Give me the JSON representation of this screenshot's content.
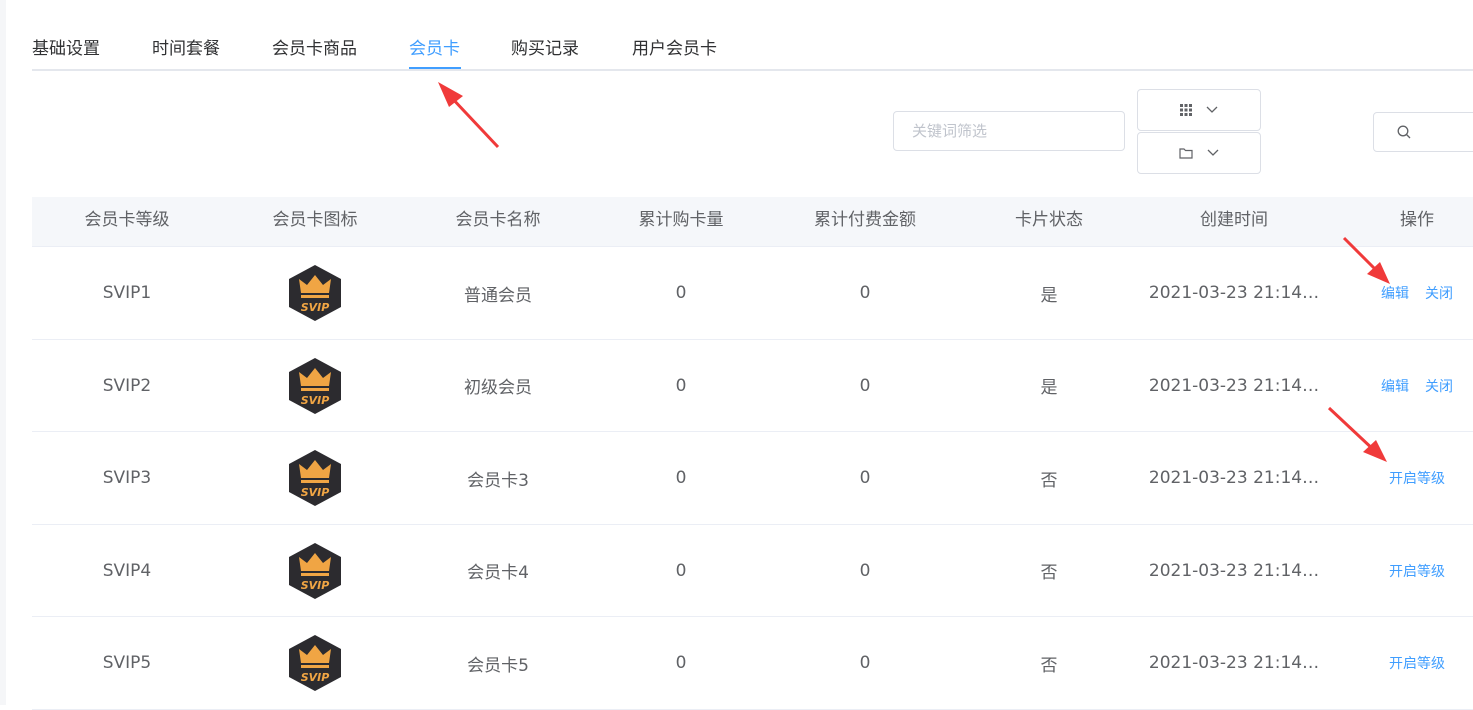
{
  "tabs": [
    {
      "label": "基础设置",
      "active": false
    },
    {
      "label": "时间套餐",
      "active": false
    },
    {
      "label": "会员卡商品",
      "active": false
    },
    {
      "label": "会员卡",
      "active": true
    },
    {
      "label": "购买记录",
      "active": false
    },
    {
      "label": "用户会员卡",
      "active": false
    }
  ],
  "toolbar": {
    "search_placeholder": "关键词筛选",
    "search_value": "",
    "column_icon": "grid-icon",
    "export_icon": "folder-icon",
    "search_icon": "search-icon"
  },
  "table": {
    "headers": [
      "会员卡等级",
      "会员卡图标",
      "会员卡名称",
      "累计购卡量",
      "累计付费金额",
      "卡片状态",
      "创建时间",
      "操作"
    ],
    "rows": [
      {
        "level": "SVIP1",
        "badge": "SVIP",
        "name": "普通会员",
        "count": "0",
        "amount": "0",
        "status": "是",
        "created": "2021-03-23 21:14…",
        "actions": [
          "编辑",
          "关闭"
        ]
      },
      {
        "level": "SVIP2",
        "badge": "SVIP",
        "name": "初级会员",
        "count": "0",
        "amount": "0",
        "status": "是",
        "created": "2021-03-23 21:14…",
        "actions": [
          "编辑",
          "关闭"
        ]
      },
      {
        "level": "SVIP3",
        "badge": "SVIP",
        "name": "会员卡3",
        "count": "0",
        "amount": "0",
        "status": "否",
        "created": "2021-03-23 21:14…",
        "actions": [
          "开启等级"
        ]
      },
      {
        "level": "SVIP4",
        "badge": "SVIP",
        "name": "会员卡4",
        "count": "0",
        "amount": "0",
        "status": "否",
        "created": "2021-03-23 21:14…",
        "actions": [
          "开启等级"
        ]
      },
      {
        "level": "SVIP5",
        "badge": "SVIP",
        "name": "会员卡5",
        "count": "0",
        "amount": "0",
        "status": "否",
        "created": "2021-03-23 21:14…",
        "actions": [
          "开启等级"
        ]
      }
    ]
  },
  "colors": {
    "accent": "#409eff",
    "annotation": "#f03a3a",
    "badge_bg": "#2c2b2f",
    "badge_gold": "#f0a544"
  }
}
